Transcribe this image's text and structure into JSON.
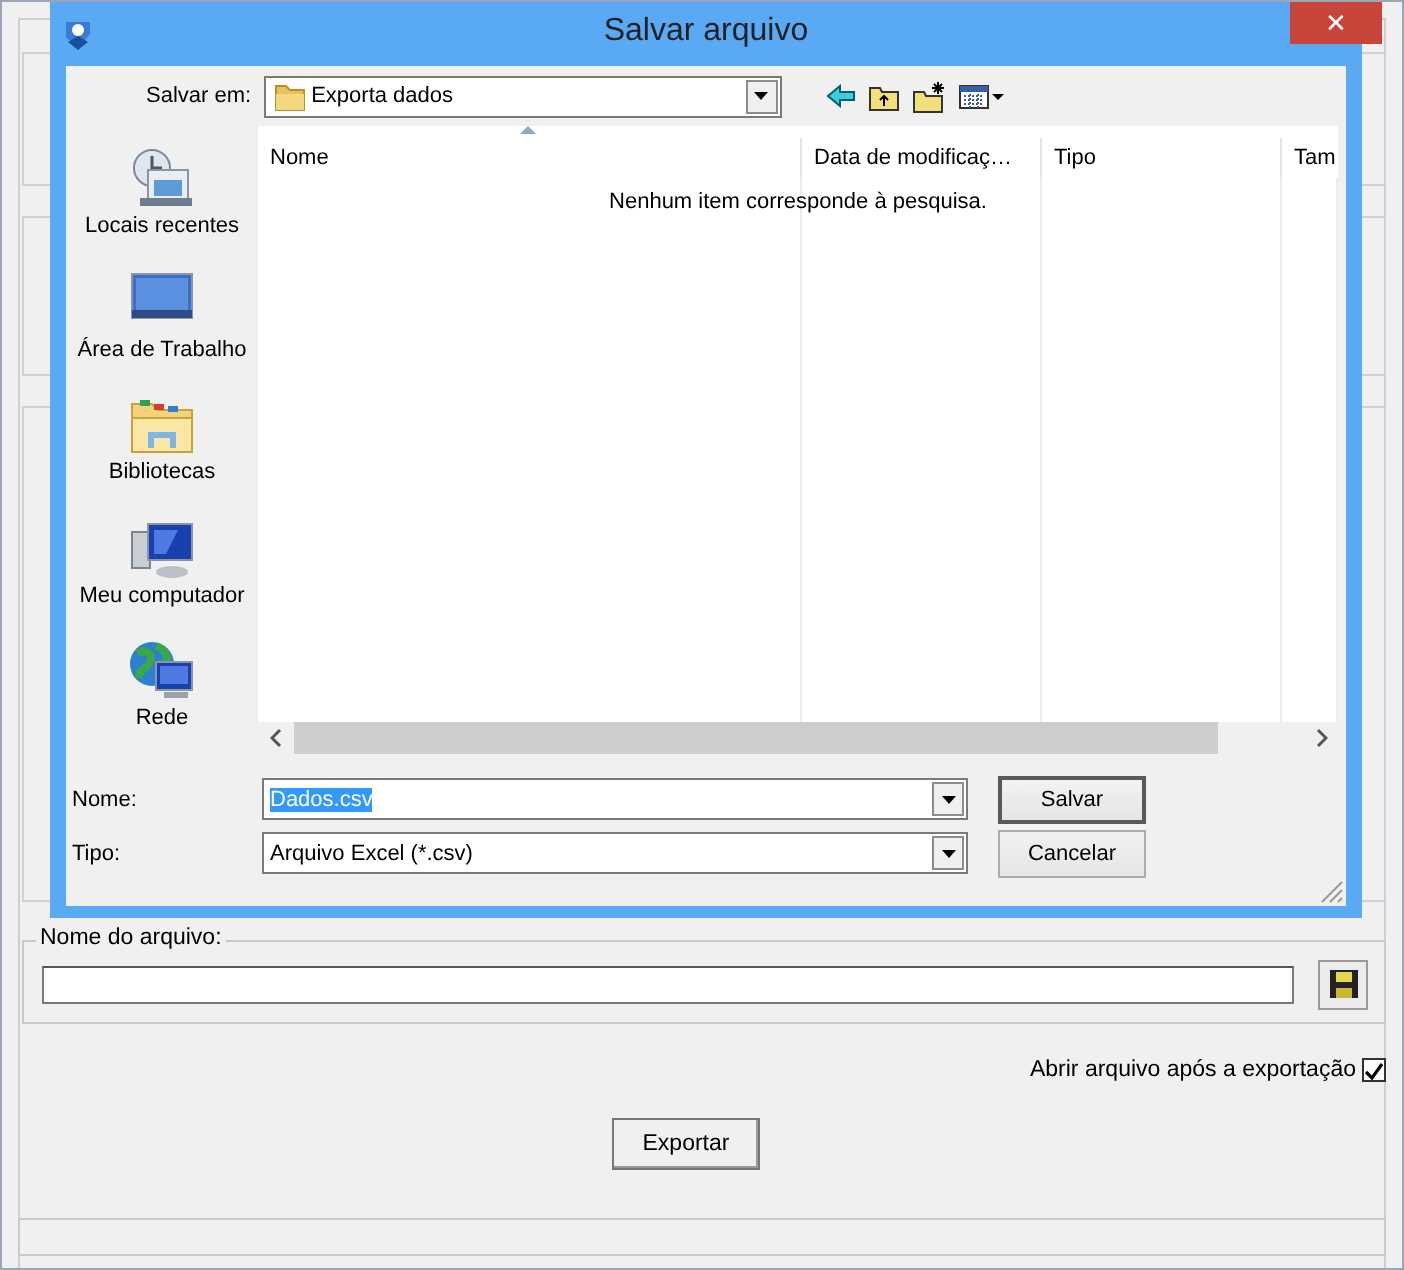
{
  "background_window": {
    "file_group": {
      "label": "Nome do arquivo:"
    },
    "open_after_export": {
      "label": "Abrir arquivo após a exportação",
      "checked": true
    },
    "export_button": "Exportar"
  },
  "dialog": {
    "title": "Salvar arquivo",
    "close": "✕",
    "save_in": {
      "label": "Salvar em:",
      "value": "Exporta dados"
    },
    "places": [
      {
        "kind": "recent",
        "label": "Locais recentes"
      },
      {
        "kind": "desktop",
        "label": "Área de Trabalho"
      },
      {
        "kind": "libraries",
        "label": "Bibliotecas"
      },
      {
        "kind": "computer",
        "label": "Meu computador"
      },
      {
        "kind": "network",
        "label": "Rede"
      }
    ],
    "columns": [
      {
        "label": "Nome",
        "sorted": true
      },
      {
        "label": "Data de modificaç…",
        "sorted": false
      },
      {
        "label": "Tipo",
        "sorted": false
      },
      {
        "label": "Tam",
        "sorted": false
      }
    ],
    "empty_message": "Nenhum item corresponde à pesquisa.",
    "name_field": {
      "label": "Nome:",
      "value": "Dados.csv",
      "selected": true
    },
    "type_field": {
      "label": "Tipo:",
      "value": "Arquivo Excel (*.csv)"
    },
    "buttons": [
      {
        "label": "Salvar",
        "default": true
      },
      {
        "label": "Cancelar",
        "default": false
      }
    ]
  }
}
